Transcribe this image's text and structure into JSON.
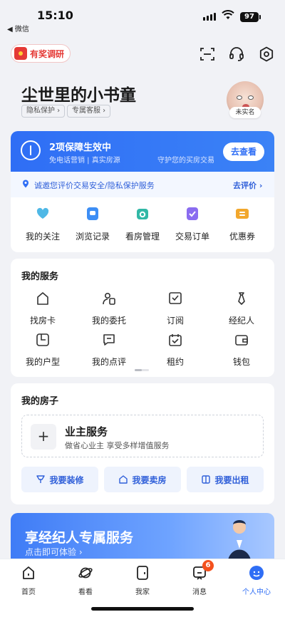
{
  "status": {
    "time": "15:10",
    "back_app": "◀ 微信",
    "battery": "97"
  },
  "top": {
    "reward_label": "有奖调研"
  },
  "profile": {
    "name": "尘世里的小书童",
    "chips": [
      "隐私保护 ›",
      "专属客服 ›"
    ],
    "avatar_tag": "未实名"
  },
  "guard": {
    "title": "2项保障生效中",
    "subtitle": "免电话营销 | 真实房源",
    "note": "守护您的买房交易",
    "button": "去查看"
  },
  "invite": {
    "text": "诚邀您评价交易安全/隐私保护服务",
    "link": "去评价 ›"
  },
  "quick_links": [
    {
      "label": "我的关注",
      "icon": "heart-icon",
      "color": "#4fb8e6"
    },
    {
      "label": "浏览记录",
      "icon": "browse-history-icon",
      "color": "#3d8ef5"
    },
    {
      "label": "看房管理",
      "icon": "house-viewing-icon",
      "color": "#31b8a6"
    },
    {
      "label": "交易订单",
      "icon": "order-check-icon",
      "color": "#8a6cf0"
    },
    {
      "label": "优惠券",
      "icon": "coupon-icon",
      "color": "#f2a72c"
    }
  ],
  "services": {
    "title": "我的服务",
    "items": [
      {
        "label": "找房卡",
        "icon": "house-card-icon"
      },
      {
        "label": "我的委托",
        "icon": "entrust-icon"
      },
      {
        "label": "订阅",
        "icon": "subscribe-icon"
      },
      {
        "label": "经纪人",
        "icon": "agent-icon"
      },
      {
        "label": "我的户型",
        "icon": "floorplan-icon"
      },
      {
        "label": "我的点评",
        "icon": "review-icon"
      },
      {
        "label": "租约",
        "icon": "lease-icon"
      },
      {
        "label": "钱包",
        "icon": "wallet-icon"
      }
    ]
  },
  "house": {
    "title": "我的房子",
    "owner_title": "业主服务",
    "owner_sub": "做省心业主 享受多样增值服务",
    "actions": [
      {
        "label": "我要装修",
        "icon": "decorate-icon"
      },
      {
        "label": "我要卖房",
        "icon": "sell-house-icon"
      },
      {
        "label": "我要出租",
        "icon": "rent-out-icon"
      }
    ]
  },
  "banner": {
    "title": "享经纪人专属服务",
    "subtitle": "点击即可体验 ›"
  },
  "tabs": [
    {
      "label": "首页",
      "icon": "home-icon"
    },
    {
      "label": "看看",
      "icon": "planet-icon"
    },
    {
      "label": "我家",
      "icon": "door-icon"
    },
    {
      "label": "消息",
      "icon": "message-icon"
    },
    {
      "label": "个人中心",
      "icon": "profile-icon"
    }
  ],
  "message_badge": "6",
  "colors": {
    "accent": "#2f6ef5",
    "badge": "#f4511e"
  }
}
